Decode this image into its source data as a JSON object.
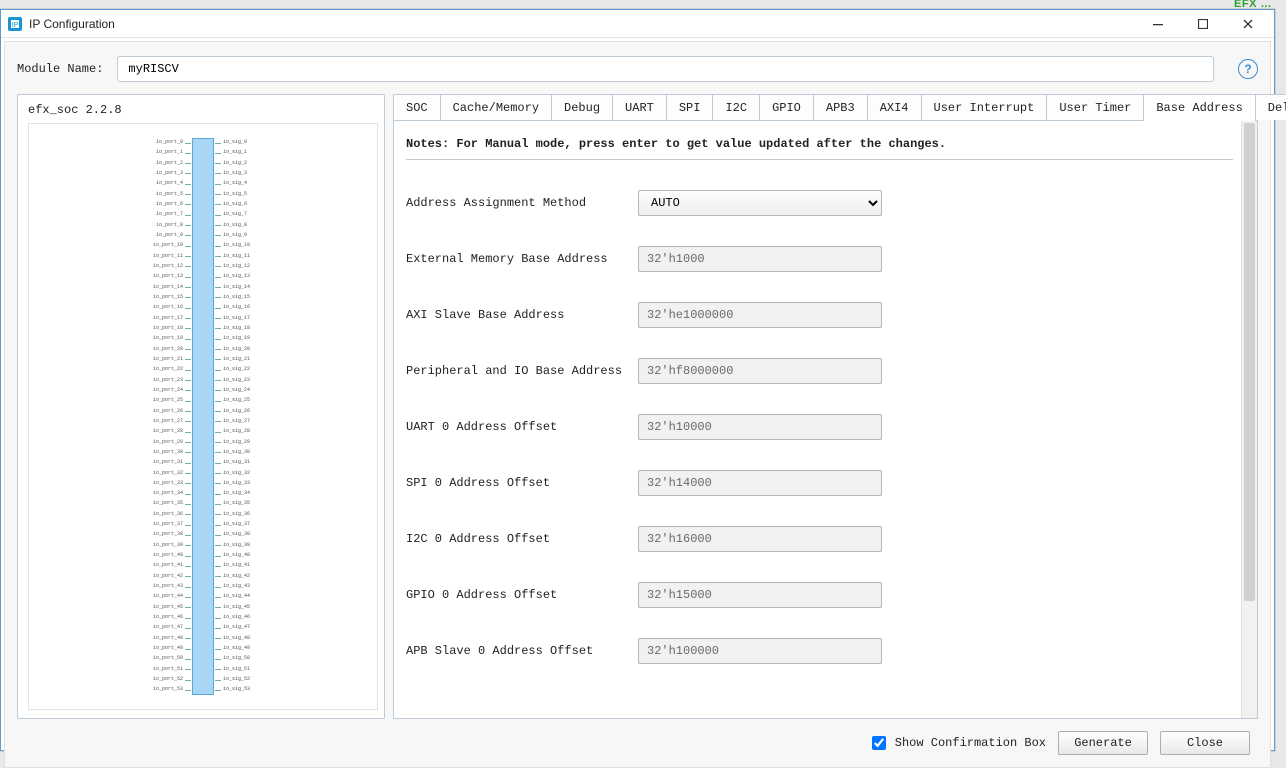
{
  "bg_hint": "EFX …",
  "window": {
    "title": "IP Configuration"
  },
  "module": {
    "label": "Module Name:",
    "value": "myRISCV"
  },
  "left": {
    "title": "efx_soc 2.2.8"
  },
  "tabs": {
    "items": [
      {
        "label": "SOC"
      },
      {
        "label": "Cache/Memory"
      },
      {
        "label": "Debug"
      },
      {
        "label": "UART"
      },
      {
        "label": "SPI"
      },
      {
        "label": "I2C"
      },
      {
        "label": "GPIO"
      },
      {
        "label": "APB3"
      },
      {
        "label": "AXI4"
      },
      {
        "label": "User Interrupt"
      },
      {
        "label": "User Timer"
      },
      {
        "label": "Base Address"
      },
      {
        "label": "Deliverables"
      }
    ],
    "active_index": 11
  },
  "notes": "Notes: For Manual mode, press enter to get value updated after the changes.",
  "form": {
    "method": {
      "label": "Address Assignment Method",
      "value": "AUTO"
    },
    "rows": [
      {
        "label": "External Memory Base Address",
        "value": "32'h1000"
      },
      {
        "label": "AXI Slave Base Address",
        "value": "32'he1000000"
      },
      {
        "label": "Peripheral and IO Base Address",
        "value": "32'hf8000000"
      },
      {
        "label": "UART 0 Address Offset",
        "value": "32'h10000"
      },
      {
        "label": "SPI 0 Address Offset",
        "value": "32'h14000"
      },
      {
        "label": "I2C 0 Address Offset",
        "value": "32'h16000"
      },
      {
        "label": "GPIO 0 Address Offset",
        "value": "32'h15000"
      },
      {
        "label": "APB Slave 0 Address Offset",
        "value": "32'h100000"
      }
    ]
  },
  "footer": {
    "checkbox_label": "Show Confirmation Box",
    "checkbox_checked": true,
    "generate": "Generate",
    "close": "Close"
  }
}
